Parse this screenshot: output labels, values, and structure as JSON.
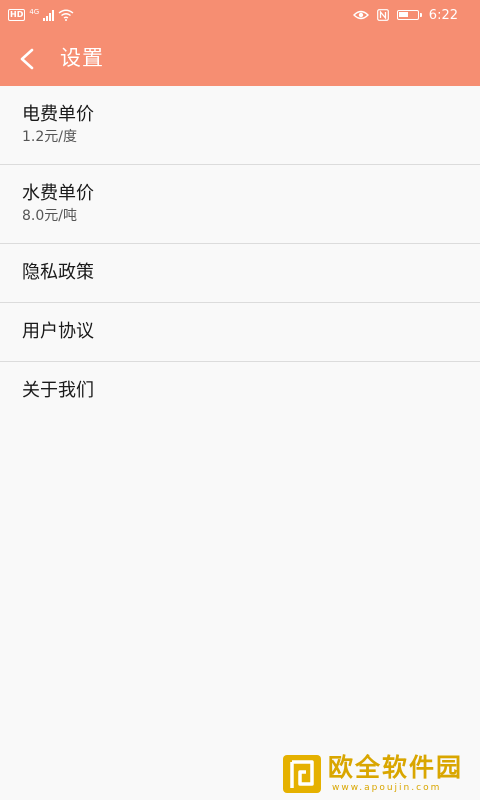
{
  "colors": {
    "header_bg": "#f68e72",
    "page_bg": "#f9f9f9",
    "divider": "#dcdcdc",
    "primary_text": "#1a1a1a",
    "secondary_text": "#555555",
    "watermark": "#d9a600"
  },
  "status_bar": {
    "hd_badge": "HD",
    "network": "4G",
    "battery_level": 0.5,
    "time": "6:22",
    "icons": [
      "signal-icon",
      "wifi-icon",
      "eye-icon",
      "nfc-icon",
      "battery-icon"
    ]
  },
  "header": {
    "back_icon": "chevron-left-icon",
    "title": "设置"
  },
  "settings": {
    "electricity": {
      "label": "电费单价",
      "value": "1.2元/度"
    },
    "water": {
      "label": "水费单价",
      "value": "8.0元/吨"
    },
    "privacy": {
      "label": "隐私政策"
    },
    "agreement": {
      "label": "用户协议"
    },
    "about": {
      "label": "关于我们"
    }
  },
  "watermark": {
    "name": "欧全软件园",
    "url": "www.apoujin.com"
  }
}
